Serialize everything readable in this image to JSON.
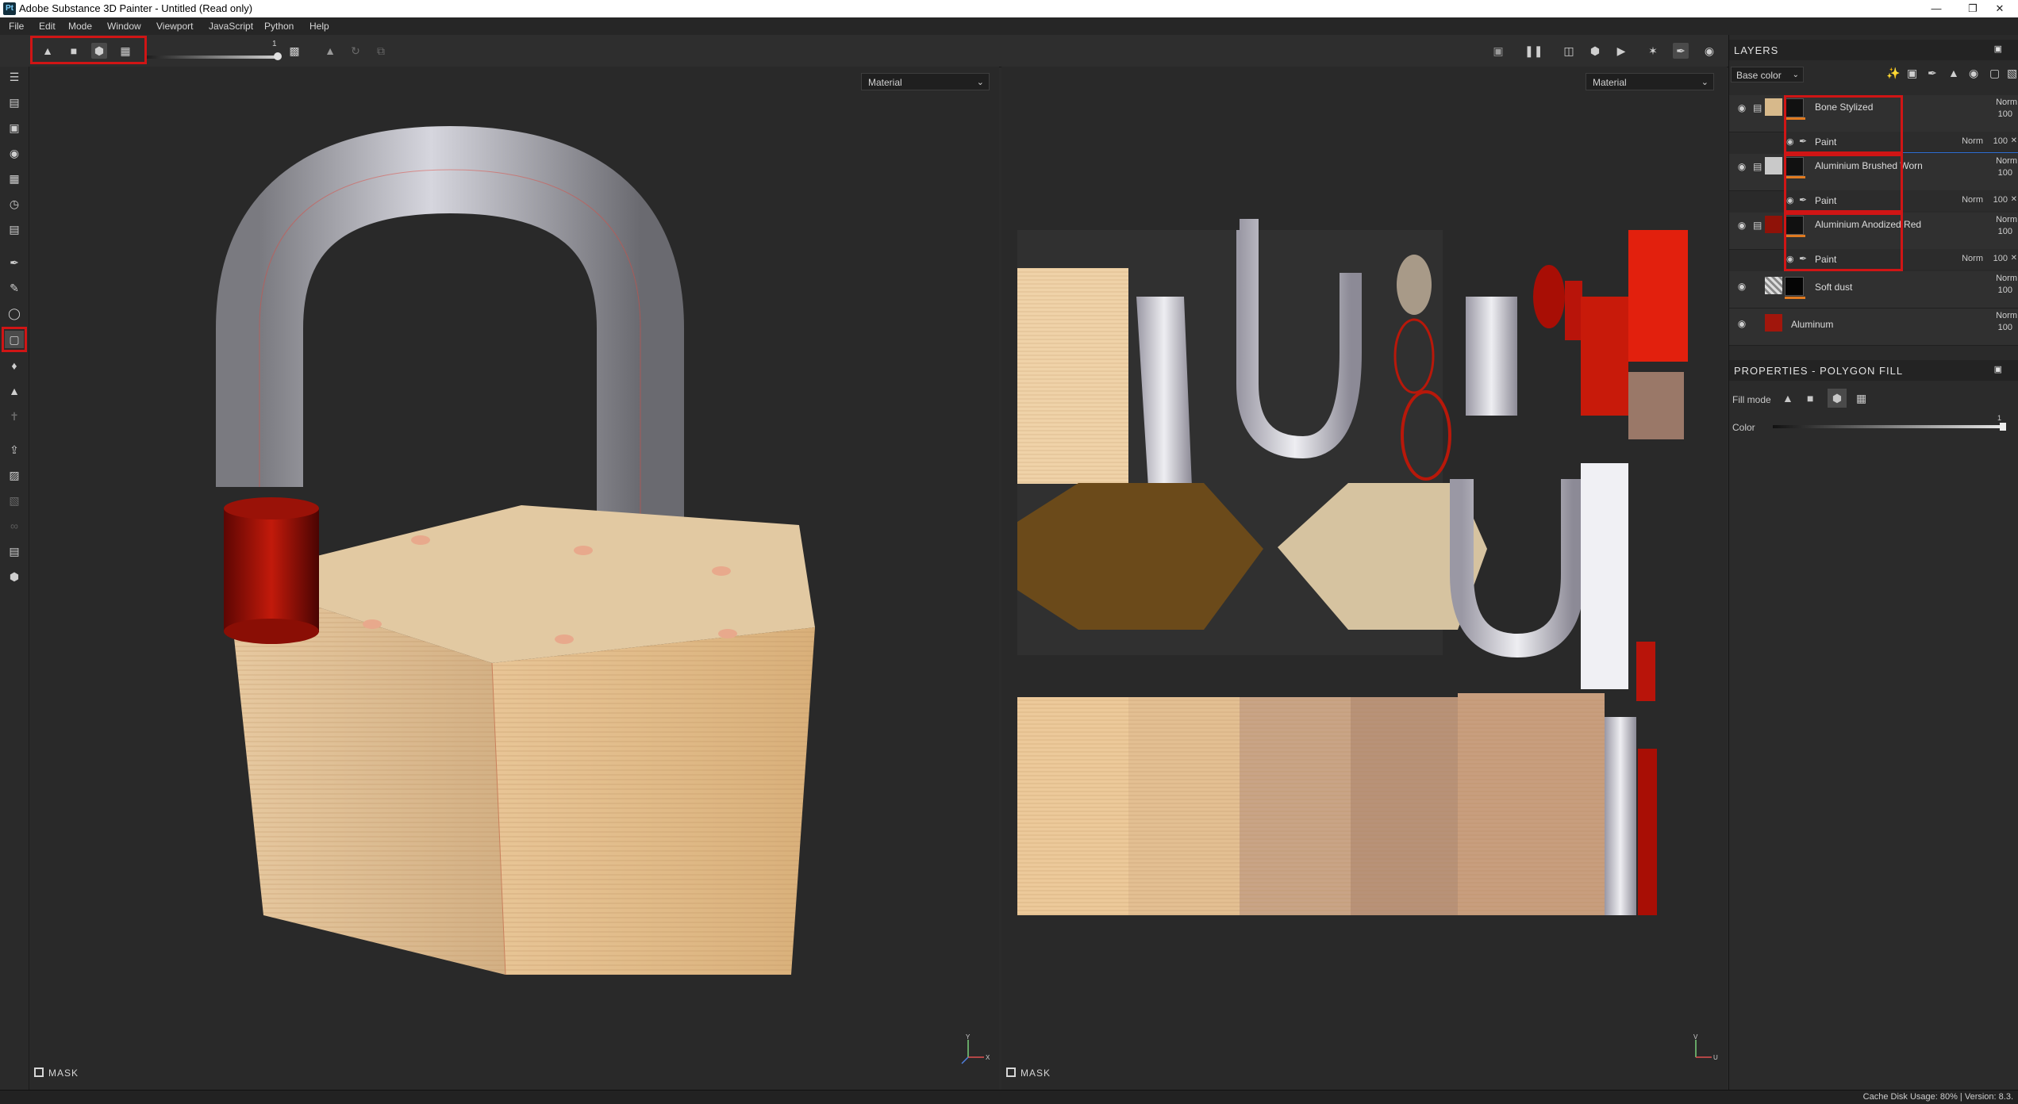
{
  "window": {
    "title": "Adobe Substance 3D Painter - Untitled (Read only)",
    "app_icon": "Pt",
    "minimize": "—",
    "maximize": "❐",
    "close": "✕"
  },
  "menu": [
    "File",
    "Edit",
    "Mode",
    "Window",
    "Viewport",
    "JavaScript",
    "Python",
    "Help"
  ],
  "toolbar": {
    "slider_value": "1"
  },
  "viewports": {
    "left_mode": "Material",
    "right_mode": "Material",
    "mask_label": "MASK",
    "axis_left": {
      "x": "X",
      "y": "Y"
    },
    "axis_right": {
      "u": "U",
      "v": "V"
    }
  },
  "layers": {
    "title": "LAYERS",
    "channel": "Base color",
    "items": [
      {
        "name": "Bone Stylized",
        "blend": "Norm",
        "opacity": "100",
        "swatch": "#d7b98b",
        "sub": {
          "name": "Paint",
          "blend": "Norm",
          "opacity": "100"
        }
      },
      {
        "name": "Aluminium Brushed Worn",
        "blend": "Norm",
        "opacity": "100",
        "swatch": "#c9c9c9",
        "sub": {
          "name": "Paint",
          "blend": "Norm",
          "opacity": "100"
        }
      },
      {
        "name": "Aluminium Anodized Red",
        "blend": "Norm",
        "opacity": "100",
        "swatch": "#8f1208",
        "sub": {
          "name": "Paint",
          "blend": "Norm",
          "opacity": "100"
        }
      },
      {
        "name": "Soft dust",
        "blend": "Norm",
        "opacity": "100"
      },
      {
        "name": "Aluminum",
        "blend": "Norm",
        "opacity": "100"
      }
    ]
  },
  "properties": {
    "title": "PROPERTIES - POLYGON FILL",
    "fill_mode_label": "Fill mode",
    "color_label": "Color",
    "color_value": "1"
  },
  "status": {
    "text": "Cache Disk Usage:   80% | Version: 8.3."
  },
  "colors": {
    "highlight": "#d01515",
    "bone": "#d7b98b",
    "red_anodized": "#b01408",
    "metal": "#a8a8ac"
  }
}
